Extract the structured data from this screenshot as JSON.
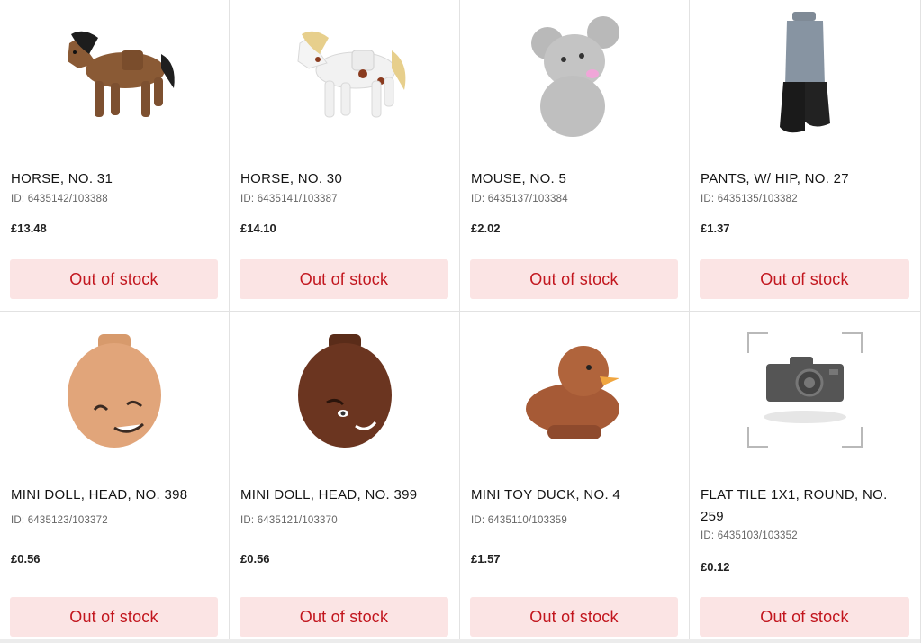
{
  "products": [
    {
      "name": "HORSE, NO. 31",
      "id": "ID: 6435142/103388",
      "price": "£13.48",
      "button": "Out of stock",
      "icon": "brown-horse-icon"
    },
    {
      "name": "HORSE, NO. 30",
      "id": "ID: 6435141/103387",
      "price": "£14.10",
      "button": "Out of stock",
      "icon": "white-horse-icon"
    },
    {
      "name": "MOUSE, NO. 5",
      "id": "ID: 6435137/103384",
      "price": "£2.02",
      "button": "Out of stock",
      "icon": "grey-mouse-icon"
    },
    {
      "name": "PANTS, W/ HIP, NO. 27",
      "id": "ID: 6435135/103382",
      "price": "£1.37",
      "button": "Out of stock",
      "icon": "pants-boots-icon"
    },
    {
      "name": "MINI DOLL, HEAD, NO. 398",
      "id": "ID: 6435123/103372",
      "price": "£0.56",
      "button": "Out of stock",
      "icon": "doll-head-light-icon"
    },
    {
      "name": "MINI DOLL, HEAD, NO. 399",
      "id": "ID: 6435121/103370",
      "price": "£0.56",
      "button": "Out of stock",
      "icon": "doll-head-dark-icon"
    },
    {
      "name": "MINI TOY DUCK, NO. 4",
      "id": "ID: 6435110/103359",
      "price": "£1.57",
      "button": "Out of stock",
      "icon": "toy-duck-icon"
    },
    {
      "name": "FLAT TILE 1X1, ROUND, NO. 259",
      "id": "ID: 6435103/103352",
      "price": "£0.12",
      "button": "Out of stock",
      "icon": "camera-placeholder-icon"
    }
  ],
  "colors": {
    "button_bg": "#fbe4e4",
    "button_text": "#c2161e"
  }
}
